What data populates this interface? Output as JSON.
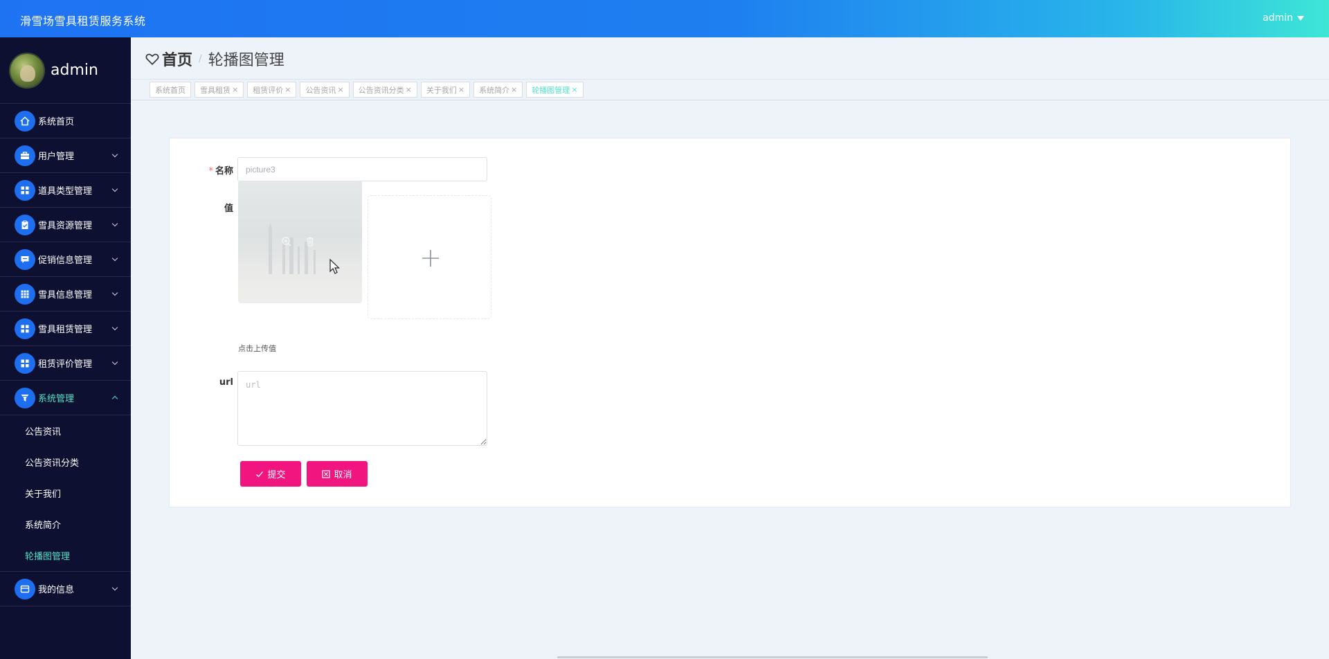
{
  "app": {
    "title": "滑雪场雪具租赁服务系统",
    "user": "admin"
  },
  "sidebar": {
    "profile_name": "admin",
    "items": [
      {
        "label": "系统首页",
        "icon": "home-icon",
        "has_children": false
      },
      {
        "label": "用户管理",
        "icon": "briefcase-icon",
        "has_children": true
      },
      {
        "label": "道具类型管理",
        "icon": "grid-icon",
        "has_children": true
      },
      {
        "label": "雪具资源管理",
        "icon": "clipboard-icon",
        "has_children": true
      },
      {
        "label": "促销信息管理",
        "icon": "chat-icon",
        "has_children": true
      },
      {
        "label": "雪具信息管理",
        "icon": "apps-icon",
        "has_children": true
      },
      {
        "label": "雪具租赁管理",
        "icon": "grid-icon",
        "has_children": true
      },
      {
        "label": "租赁评价管理",
        "icon": "grid-icon",
        "has_children": true
      },
      {
        "label": "系统管理",
        "icon": "funnel-icon",
        "has_children": true,
        "expanded": true
      },
      {
        "label": "我的信息",
        "icon": "card-icon",
        "has_children": true
      }
    ],
    "system_children": [
      "公告资讯",
      "公告资讯分类",
      "关于我们",
      "系统简介",
      "轮播图管理"
    ],
    "active_child": "轮播图管理"
  },
  "breadcrumb": {
    "home": "首页",
    "separator": "/",
    "current": "轮播图管理"
  },
  "tags": [
    {
      "label": "系统首页",
      "closable": false,
      "active": false
    },
    {
      "label": "雪具租赁",
      "closable": true,
      "active": false
    },
    {
      "label": "租赁评价",
      "closable": true,
      "active": false
    },
    {
      "label": "公告资讯",
      "closable": true,
      "active": false
    },
    {
      "label": "公告资讯分类",
      "closable": true,
      "active": false
    },
    {
      "label": "关于我们",
      "closable": true,
      "active": false
    },
    {
      "label": "系统简介",
      "closable": true,
      "active": false
    },
    {
      "label": "轮播图管理",
      "closable": true,
      "active": true
    }
  ],
  "form": {
    "name_label": "名称",
    "name_placeholder": "picture3",
    "value_label": "值",
    "upload_hint": "点击上传值",
    "url_label": "url",
    "url_placeholder": "url",
    "submit_label": "提交",
    "cancel_label": "取消"
  },
  "colors": {
    "accent": "#4fe3c9",
    "primary_blue": "#1e6ff0",
    "button_pink": "#f0157f",
    "sidebar_bg": "#0d1030"
  }
}
